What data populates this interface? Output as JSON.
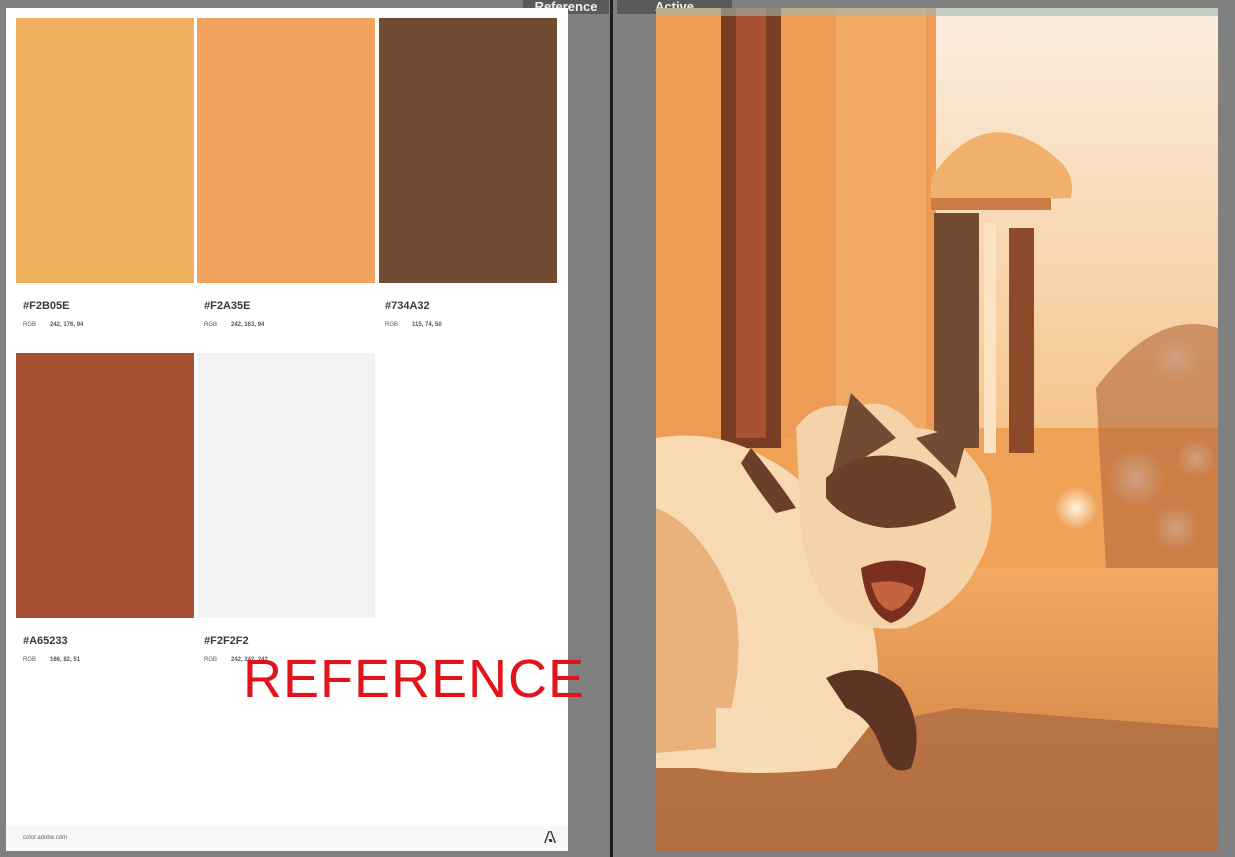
{
  "tabs": {
    "reference": "Reference",
    "active": "Active"
  },
  "palette": [
    {
      "hex": "#F2B05E",
      "rgb_label": "RGB",
      "rgb": "242, 176, 94",
      "color": "#F2B05E"
    },
    {
      "hex": "#F2A35E",
      "rgb_label": "RGB",
      "rgb": "242, 163, 94",
      "color": "#F2A35E"
    },
    {
      "hex": "#734A32",
      "rgb_label": "RGB",
      "rgb": "115, 74, 50",
      "color": "#734A32"
    },
    {
      "hex": "#A65233",
      "rgb_label": "RGB",
      "rgb": "166, 82, 51",
      "color": "#A65233"
    },
    {
      "hex": "#F2F2F2",
      "rgb_label": "RGB",
      "rgb": "242, 242, 242",
      "color": "#F2F2F2"
    }
  ],
  "watermark": "REFERENCE",
  "footer": {
    "url": "color.adobe.com",
    "logo_icon": "adobe-logo-icon"
  },
  "photo": {
    "subject_icon": "yawning-cat-photo",
    "tint": "#F2A35E"
  }
}
